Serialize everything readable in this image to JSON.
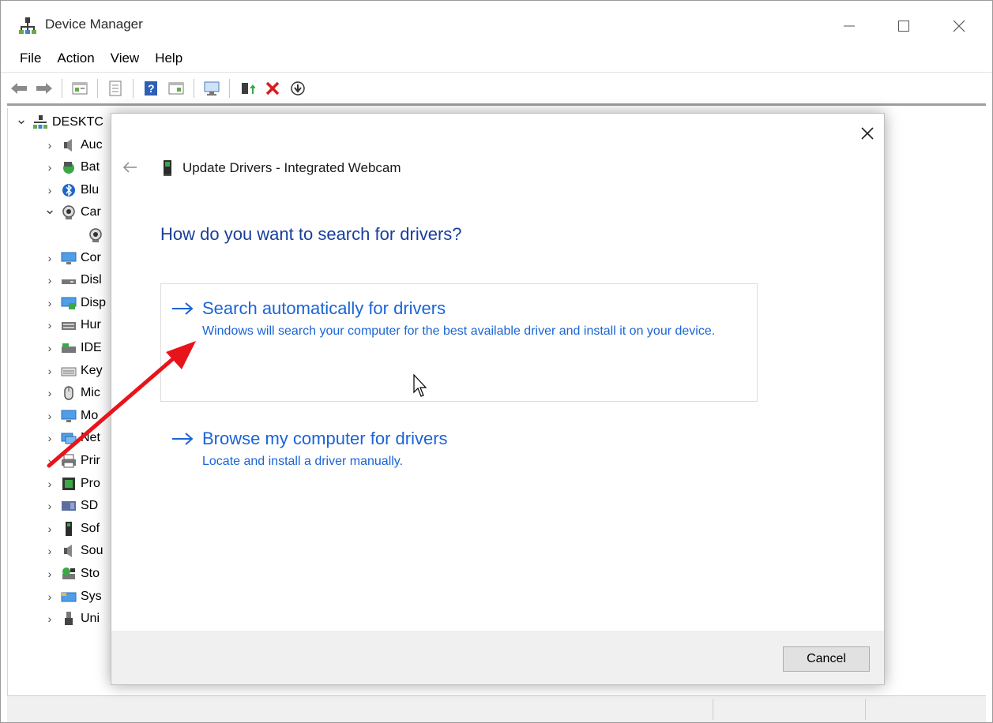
{
  "window": {
    "title": "Device Manager",
    "controls": {
      "minimize": "—",
      "maximize": "☐",
      "close": "✕"
    }
  },
  "menu": [
    "File",
    "Action",
    "View",
    "Help"
  ],
  "toolbar": {
    "icons": [
      "back-icon",
      "forward-icon",
      "properties-icon",
      "scan-icon",
      "help-icon",
      "view-icon",
      "computer-icon",
      "update-driver-icon",
      "uninstall-icon",
      "download-icon"
    ]
  },
  "tree": {
    "root": "DESKTC",
    "items": [
      {
        "label": "Auc",
        "expanded": false,
        "icon": "audio-icon"
      },
      {
        "label": "Bat",
        "expanded": false,
        "icon": "battery-icon"
      },
      {
        "label": "Blu",
        "expanded": false,
        "icon": "bluetooth-icon"
      },
      {
        "label": "Car",
        "expanded": true,
        "icon": "camera-icon"
      },
      {
        "label": "",
        "child": true,
        "icon": "webcam-icon"
      },
      {
        "label": "Cor",
        "expanded": false,
        "icon": "monitor-icon"
      },
      {
        "label": "Disl",
        "expanded": false,
        "icon": "disk-icon"
      },
      {
        "label": "Disp",
        "expanded": false,
        "icon": "display-icon"
      },
      {
        "label": "Hur",
        "expanded": false,
        "icon": "hid-icon"
      },
      {
        "label": "IDE",
        "expanded": false,
        "icon": "ide-icon"
      },
      {
        "label": "Key",
        "expanded": false,
        "icon": "keyboard-icon"
      },
      {
        "label": "Mic",
        "expanded": false,
        "icon": "mouse-icon"
      },
      {
        "label": "Mo",
        "expanded": false,
        "icon": "monitor-icon"
      },
      {
        "label": "Net",
        "expanded": false,
        "icon": "network-icon"
      },
      {
        "label": "Prir",
        "expanded": false,
        "icon": "printer-icon"
      },
      {
        "label": "Pro",
        "expanded": false,
        "icon": "processor-icon"
      },
      {
        "label": "SD",
        "expanded": false,
        "icon": "sd-icon"
      },
      {
        "label": "Sof",
        "expanded": false,
        "icon": "software-icon"
      },
      {
        "label": "Sou",
        "expanded": false,
        "icon": "sound-icon"
      },
      {
        "label": "Sto",
        "expanded": false,
        "icon": "storage-icon"
      },
      {
        "label": "Sys",
        "expanded": false,
        "icon": "system-icon"
      },
      {
        "label": "Uni",
        "expanded": false,
        "icon": "usb-icon"
      }
    ]
  },
  "dialog": {
    "header": "Update Drivers - Integrated Webcam",
    "question": "How do you want to search for drivers?",
    "options": [
      {
        "title": "Search automatically for drivers",
        "description": "Windows will search your computer for the best available driver and install it on your device."
      },
      {
        "title": "Browse my computer for drivers",
        "description": "Locate and install a driver manually."
      }
    ],
    "cancel": "Cancel"
  },
  "colors": {
    "link_blue": "#1a64d6",
    "heading_blue": "#1a3e9c",
    "annotation_red": "#e8141b"
  }
}
